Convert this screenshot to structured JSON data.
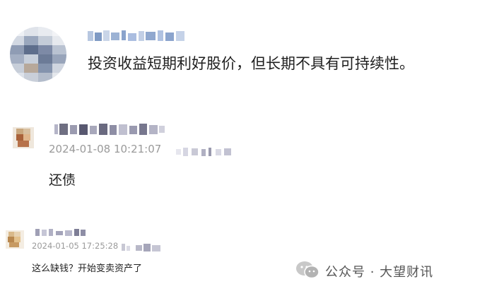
{
  "comments": [
    {
      "text": "投资收益短期利好股价，但长期不具有可持续性。"
    },
    {
      "timestamp": "2024-01-08 10:21:07",
      "text": "还债"
    },
    {
      "timestamp": "2024-01-05 17:25:28",
      "text": "这么缺钱？开始变卖资产了"
    }
  ],
  "watermark": {
    "text": "公众号 · 大望财讯",
    "icon": "wechat-icon"
  }
}
